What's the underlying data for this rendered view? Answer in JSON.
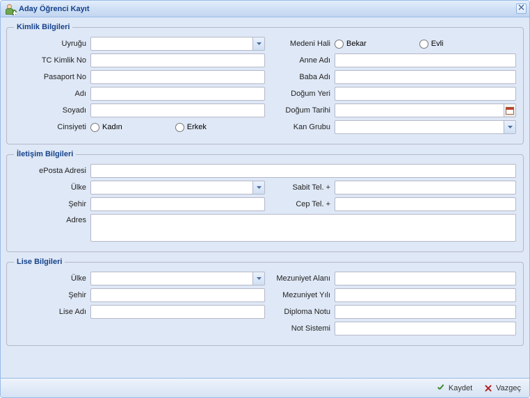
{
  "window": {
    "title": "Aday Öğrenci Kayıt"
  },
  "sections": {
    "identity": {
      "legend": "Kimlik Bilgileri",
      "labels": {
        "uyrugu": "Uyruğu",
        "tc_kimlik_no": "TC Kimlik No",
        "pasaport_no": "Pasaport No",
        "adi": "Adı",
        "soyadi": "Soyadı",
        "cinsiyeti": "Cinsiyeti",
        "medeni_hali": "Medeni Hali",
        "anne_adi": "Anne Adı",
        "baba_adi": "Baba Adı",
        "dogum_yeri": "Doğum Yeri",
        "dogum_tarihi": "Doğum Tarihi",
        "kan_grubu": "Kan Grubu"
      },
      "options": {
        "cinsiyet_kadin": "Kadın",
        "cinsiyet_erkek": "Erkek",
        "medeni_bekar": "Bekar",
        "medeni_evli": "Evli"
      },
      "values": {
        "uyrugu": "",
        "tc_kimlik_no": "",
        "pasaport_no": "",
        "adi": "",
        "soyadi": "",
        "anne_adi": "",
        "baba_adi": "",
        "dogum_yeri": "",
        "dogum_tarihi": "",
        "kan_grubu": ""
      }
    },
    "contact": {
      "legend": "İletişim Bilgileri",
      "labels": {
        "eposta": "ePosta Adresi",
        "ulke": "Ülke",
        "sehir": "Şehir",
        "adres": "Adres",
        "sabit_tel": "Sabit Tel. +",
        "cep_tel": "Cep Tel. +"
      },
      "values": {
        "eposta": "",
        "ulke": "",
        "sehir": "",
        "adres": "",
        "sabit_tel": "",
        "cep_tel": ""
      }
    },
    "school": {
      "legend": "Lise Bilgileri",
      "labels": {
        "ulke": "Ülke",
        "sehir": "Şehir",
        "lise_adi": "Lise Adı",
        "mezuniyet_alani": "Mezuniyet Alanı",
        "mezuniyet_yili": "Mezuniyet Yılı",
        "diploma_notu": "Diploma Notu",
        "not_sistemi": "Not Sistemi"
      },
      "values": {
        "ulke": "",
        "sehir": "",
        "lise_adi": "",
        "mezuniyet_alani": "",
        "mezuniyet_yili": "",
        "diploma_notu": "",
        "not_sistemi": ""
      }
    }
  },
  "footer": {
    "save": "Kaydet",
    "cancel": "Vazgeç"
  }
}
